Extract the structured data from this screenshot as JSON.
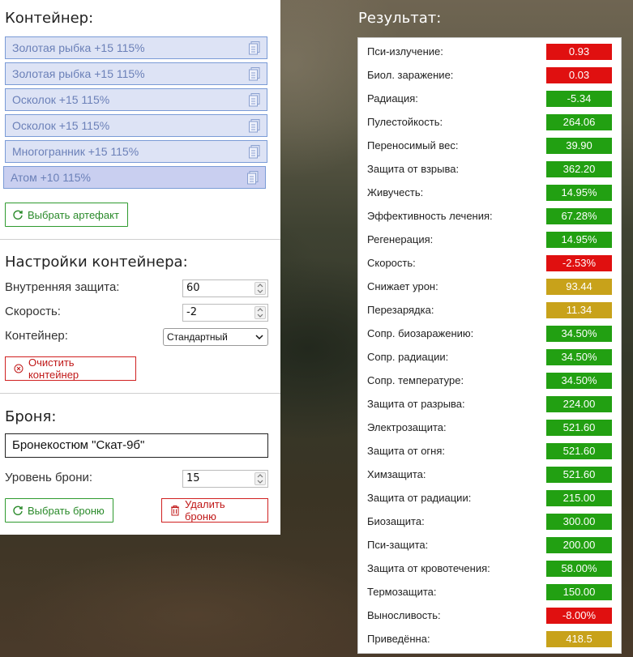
{
  "container": {
    "title": "Контейнер:",
    "artifacts": [
      {
        "label": "Золотая рыбка +15 115%"
      },
      {
        "label": "Золотая рыбка +15 115%"
      },
      {
        "label": "Осколок +15 115%"
      },
      {
        "label": "Осколок +15 115%"
      },
      {
        "label": "Многогранник +15 115%"
      },
      {
        "label": "Атом +10 115%"
      }
    ],
    "choose_artifact_label": "Выбрать артефакт"
  },
  "settings": {
    "title": "Настройки контейнера:",
    "inner_protection_label": "Внутренняя защита:",
    "inner_protection_value": "60",
    "speed_label": "Скорость:",
    "speed_value": "-2",
    "container_label": "Контейнер:",
    "container_value": "Стандартный",
    "clear_label": "Очистить контейнер"
  },
  "armor": {
    "title": "Броня:",
    "name": "Бронекостюм \"Скат-9б\"",
    "level_label": "Уровень брони:",
    "level_value": "15",
    "choose_label": "Выбрать броню",
    "delete_label": "Удалить броню"
  },
  "result": {
    "title": "Результат:",
    "rows": [
      {
        "label": "Пси-излучение:",
        "value": "0.93",
        "color": "#e01010"
      },
      {
        "label": "Биол. заражение:",
        "value": "0.03",
        "color": "#e01010"
      },
      {
        "label": "Радиация:",
        "value": "-5.34",
        "color": "#22a012"
      },
      {
        "label": "Пулестойкость:",
        "value": "264.06",
        "color": "#22a012"
      },
      {
        "label": "Переносимый вес:",
        "value": "39.90",
        "color": "#22a012"
      },
      {
        "label": "Защита от взрыва:",
        "value": "362.20",
        "color": "#22a012"
      },
      {
        "label": "Живучесть:",
        "value": "14.95%",
        "color": "#22a012"
      },
      {
        "label": "Эффективность лечения:",
        "value": "67.28%",
        "color": "#22a012"
      },
      {
        "label": "Регенерация:",
        "value": "14.95%",
        "color": "#22a012"
      },
      {
        "label": "Скорость:",
        "value": "-2.53%",
        "color": "#e01010"
      },
      {
        "label": "Снижает урон:",
        "value": "93.44",
        "color": "#c8a21a"
      },
      {
        "label": "Перезарядка:",
        "value": "11.34",
        "color": "#c8a21a"
      },
      {
        "label": "Сопр. биозаражению:",
        "value": "34.50%",
        "color": "#22a012"
      },
      {
        "label": "Сопр. радиации:",
        "value": "34.50%",
        "color": "#22a012"
      },
      {
        "label": "Сопр. температуре:",
        "value": "34.50%",
        "color": "#22a012"
      },
      {
        "label": "Защита от разрыва:",
        "value": "224.00",
        "color": "#22a012"
      },
      {
        "label": "Электрозащита:",
        "value": "521.60",
        "color": "#22a012"
      },
      {
        "label": "Защита от огня:",
        "value": "521.60",
        "color": "#22a012"
      },
      {
        "label": "Химзащита:",
        "value": "521.60",
        "color": "#22a012"
      },
      {
        "label": "Защита от радиации:",
        "value": "215.00",
        "color": "#22a012"
      },
      {
        "label": "Биозащита:",
        "value": "300.00",
        "color": "#22a012"
      },
      {
        "label": "Пси-защита:",
        "value": "200.00",
        "color": "#22a012"
      },
      {
        "label": "Защита от кровотечения:",
        "value": "58.00%",
        "color": "#22a012"
      },
      {
        "label": "Термозащита:",
        "value": "150.00",
        "color": "#22a012"
      },
      {
        "label": "Выносливость:",
        "value": "-8.00%",
        "color": "#e01010"
      },
      {
        "label": "Приведённа:",
        "value": "418.5",
        "color": "#c8a21a"
      }
    ]
  }
}
